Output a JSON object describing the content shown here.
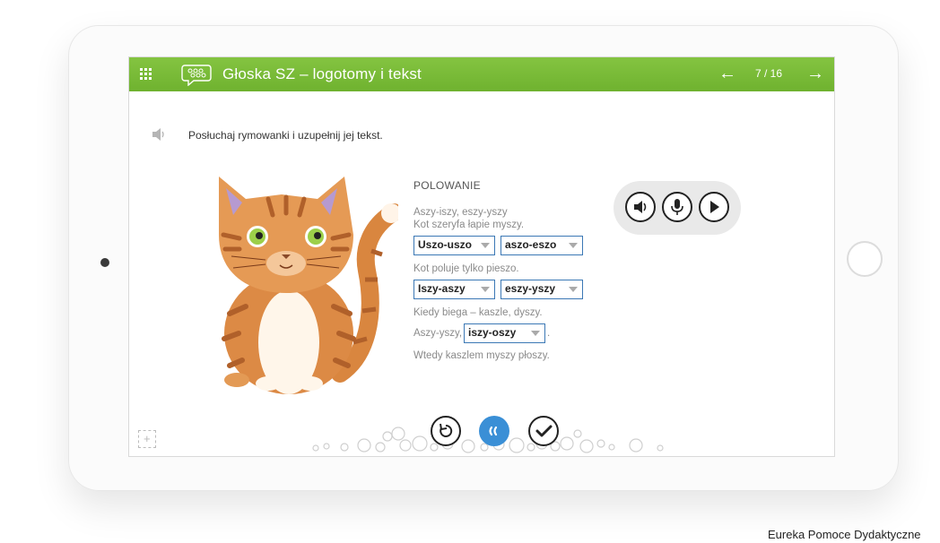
{
  "header": {
    "title": "Głoska SZ – logotomy i tekst",
    "page_indicator": "7 / 16",
    "menu_icon": "grid-menu-icon",
    "lesson_icon": "speech-bubble-icon",
    "prev_icon": "arrow-left-icon",
    "next_icon": "arrow-right-icon",
    "accent_color": "#7cbd3a"
  },
  "instruction": {
    "icon": "speaker-icon",
    "text": "Posłuchaj rymowanki i uzupełnij jej tekst."
  },
  "poem": {
    "title": "POLOWANIE",
    "line1": "Aszy-iszy, eszy-yszy",
    "line2": "Kot szeryfa łapie myszy.",
    "select1": "Uszo-uszo",
    "select2": "aszo-eszo",
    "line3": "Kot poluje tylko pieszo.",
    "select3": "Iszy-aszy",
    "select4": "eszy-yszy",
    "line4": "Kiedy biega – kaszle, dyszy.",
    "line5_prefix": "Aszy-yszy,",
    "select5": "iszy-oszy",
    "line5_suffix": ".",
    "line6": "Wtedy kaszlem myszy płoszy.",
    "select_border_color": "#3b78b5"
  },
  "audio_panel": {
    "buttons": [
      "speaker-icon",
      "microphone-icon",
      "play-icon"
    ]
  },
  "bottom_controls": {
    "buttons": [
      "undo-icon",
      "hint-icon",
      "check-icon"
    ],
    "hint_color": "#3a8fd6"
  },
  "watermark": "Eureka Pomoce Dydaktyczne"
}
